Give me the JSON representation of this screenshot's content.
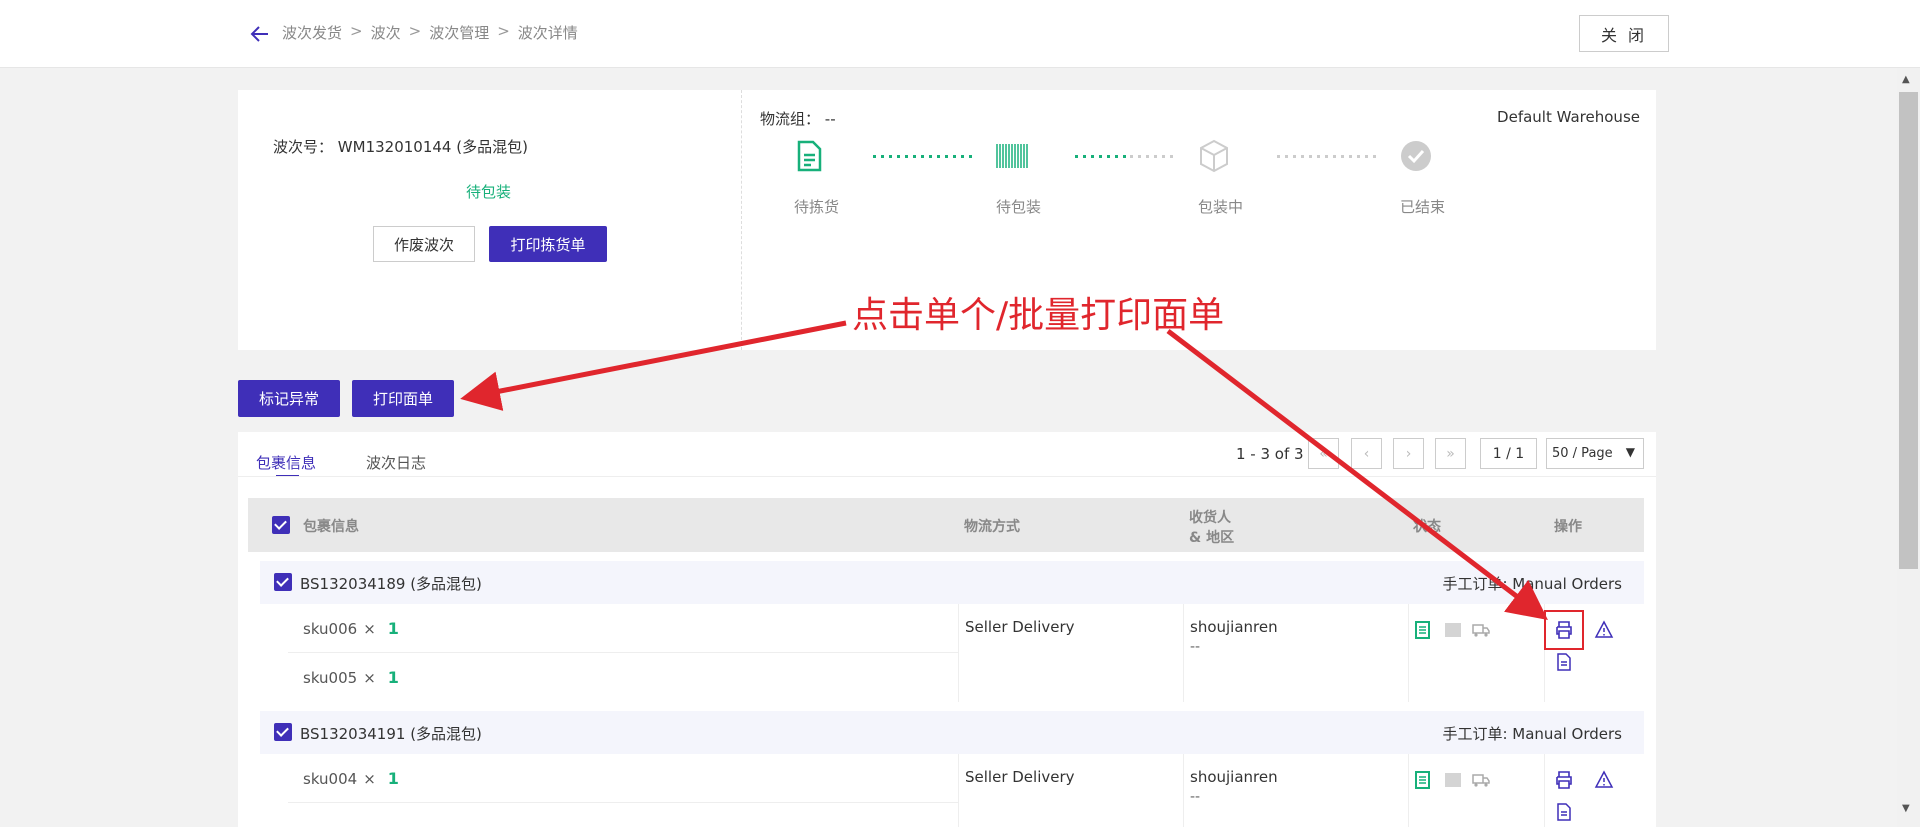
{
  "breadcrumb": {
    "items": [
      "波次发货",
      "波次",
      "波次管理",
      "波次详情"
    ],
    "separator": ">"
  },
  "header": {
    "close_label": "关 闭"
  },
  "wave": {
    "number_label": "波次号：",
    "number": "WM132010144 (多品混包)",
    "status": "待包装",
    "void_label": "作废波次",
    "print_pick_label": "打印拣货单",
    "logistics_group_label": "物流组：",
    "logistics_group_value": "--",
    "warehouse": "Default Warehouse",
    "steps": [
      {
        "label": "待拣货",
        "icon": "document-icon",
        "state": "done"
      },
      {
        "label": "待包装",
        "icon": "barcode-icon",
        "state": "current"
      },
      {
        "label": "包装中",
        "icon": "box-icon",
        "state": "pending"
      },
      {
        "label": "已结束",
        "icon": "check-circle-icon",
        "state": "pending"
      }
    ]
  },
  "actions": {
    "mark_exception": "标记异常",
    "print_label": "打印面单"
  },
  "annotation": {
    "text": "点击单个/批量打印面单"
  },
  "tabs": [
    {
      "label": "包裹信息",
      "active": true
    },
    {
      "label": "波次日志",
      "active": false
    }
  ],
  "pagination": {
    "range": "1 - 3 of 3",
    "page": "1 / 1",
    "page_size": "50 / Page"
  },
  "table": {
    "headers": {
      "package": "包裹信息",
      "shipping": "物流方式",
      "recipient_line1": "收货人",
      "recipient_line2": "& 地区",
      "status": "状态",
      "ops": "操作"
    },
    "packages": [
      {
        "id": "BS132034189 (多品混包)",
        "source": "手工订单: Manual Orders",
        "items": [
          {
            "sku": "sku006",
            "times": "×",
            "qty": "1"
          },
          {
            "sku": "sku005",
            "times": "×",
            "qty": "1"
          }
        ],
        "shipping": "Seller Delivery",
        "recipient": "shoujianren",
        "region": "--"
      },
      {
        "id": "BS132034191 (多品混包)",
        "source": "手工订单: Manual Orders",
        "items": [
          {
            "sku": "sku004",
            "times": "×",
            "qty": "1"
          }
        ],
        "shipping": "Seller Delivery",
        "recipient": "shoujianren",
        "region": "--"
      }
    ]
  },
  "colors": {
    "primary": "#3f2fb8",
    "success": "#17b07a",
    "annotation_red": "#e0262d"
  }
}
